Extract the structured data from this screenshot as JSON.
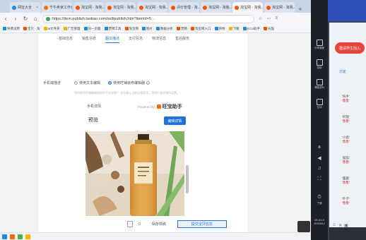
{
  "browser": {
    "tabs": [
      {
        "label": "网址大全",
        "color": "#1e88e5"
      },
      {
        "label": "千牛卖家工作台",
        "color": "#ff6a00"
      },
      {
        "label": "淘宝网 - 淘我...",
        "color": "#ff5000"
      },
      {
        "label": "淘宝网 - 淘我...",
        "color": "#ff5000"
      },
      {
        "label": "淘宝网 - 淘我...",
        "color": "#ff5000"
      },
      {
        "label": "评价管理 - 淘...",
        "color": "#ff5000"
      },
      {
        "label": "淘宝网 - 淘我...",
        "color": "#ff5000"
      },
      {
        "label": "淘宝网 - 淘我...",
        "color": "#ff5000",
        "active": true
      },
      {
        "label": "淘宝网 - 淘我...",
        "color": "#ff5000"
      }
    ],
    "new_tab_label": "+",
    "back_label": "‹",
    "forward_label": "›",
    "refresh_label": "↻",
    "home_label": "⌂",
    "url": "https://item.publish.taobao.com/sell/publish.htm?itemId=5…",
    "addr_actions": [
      "☆",
      "⋯",
      "≡"
    ]
  },
  "bookmarks": [
    {
      "label": "免费试用",
      "color": "#1e88e5"
    },
    {
      "label": "宝贝 - 淘",
      "color": "#ff5000"
    },
    {
      "label": "ai文件夹",
      "color": "#f4b400"
    },
    {
      "label": "广告管理",
      "color": "#f4b400"
    },
    {
      "label": "同一页面",
      "color": "#1e88e5"
    },
    {
      "label": "营销工具",
      "color": "#1e88e5"
    },
    {
      "label": "淘宝网",
      "color": "#ff5000"
    },
    {
      "label": "图片",
      "color": "#1e88e5"
    },
    {
      "label": "数据分析",
      "color": "#1e88e5"
    },
    {
      "label": "营销",
      "color": "#ff5000"
    },
    {
      "label": "淘宝网入口",
      "color": "#ff5000"
    },
    {
      "label": "购物",
      "color": "#1e88e5"
    },
    {
      "label": "飞猪",
      "color": "#f4b400"
    },
    {
      "label": "ECU助手",
      "color": "#1e88e5"
    },
    {
      "label": "天猫",
      "color": "#ff5000"
    }
  ],
  "steps": [
    {
      "label": "基础信息",
      "active": false
    },
    {
      "label": "销售信息",
      "active": false
    },
    {
      "label": "图文描述",
      "active": true
    },
    {
      "label": "支付信息",
      "active": false
    },
    {
      "label": "物流信息",
      "active": false
    },
    {
      "label": "售后服务",
      "active": false
    }
  ],
  "form": {
    "desc_label": "手机端描述",
    "opt_text": "使用文本编辑",
    "opt_wireless": "使用旺铺装修编辑器",
    "hint": "如何使用旺铺编辑器制作手机详情？ 请先确认当前店铺版本，再进行相关操作设置。",
    "editor_label": "手机详情",
    "powered_by": "Powered by",
    "brand": "旺宝助手"
  },
  "preview": {
    "title": "预览",
    "edit_button": "编辑详情"
  },
  "bottom": {
    "count": "0",
    "save": "保存草稿",
    "submit": "提交宝贝信息"
  },
  "iconbar": [
    {
      "label": "分享课程"
    },
    {
      "label": "录制"
    },
    {
      "label": "课程资料"
    },
    {
      "label": "互动"
    }
  ],
  "iconbar_glyphs": [
    "⚘",
    "◀",
    "♫",
    "⛶",
    "⏱"
  ],
  "iconbar_clock_label": "下课",
  "clock": {
    "time": "09:16:19",
    "date": "2023/6/12"
  },
  "chat": {
    "header": "",
    "join_button": "邀请学生加入",
    "tab": "讨论",
    "messages": [
      {
        "name": "'快手'",
        "text": "'鲁鲁'"
      },
      {
        "name": "'阿狸'",
        "text": "'鲁鲁'"
      },
      {
        "name": "'小鹿'",
        "text": "'鲁鲁'"
      },
      {
        "name": "'猫猫'",
        "text": "'鲁鲁'"
      },
      {
        "name": "'露露'",
        "text": "'鲁鲁'"
      },
      {
        "name": "'叶子'",
        "text": "'鲁鲁'"
      }
    ],
    "tools": [
      "☺",
      "✕",
      "▣"
    ]
  }
}
